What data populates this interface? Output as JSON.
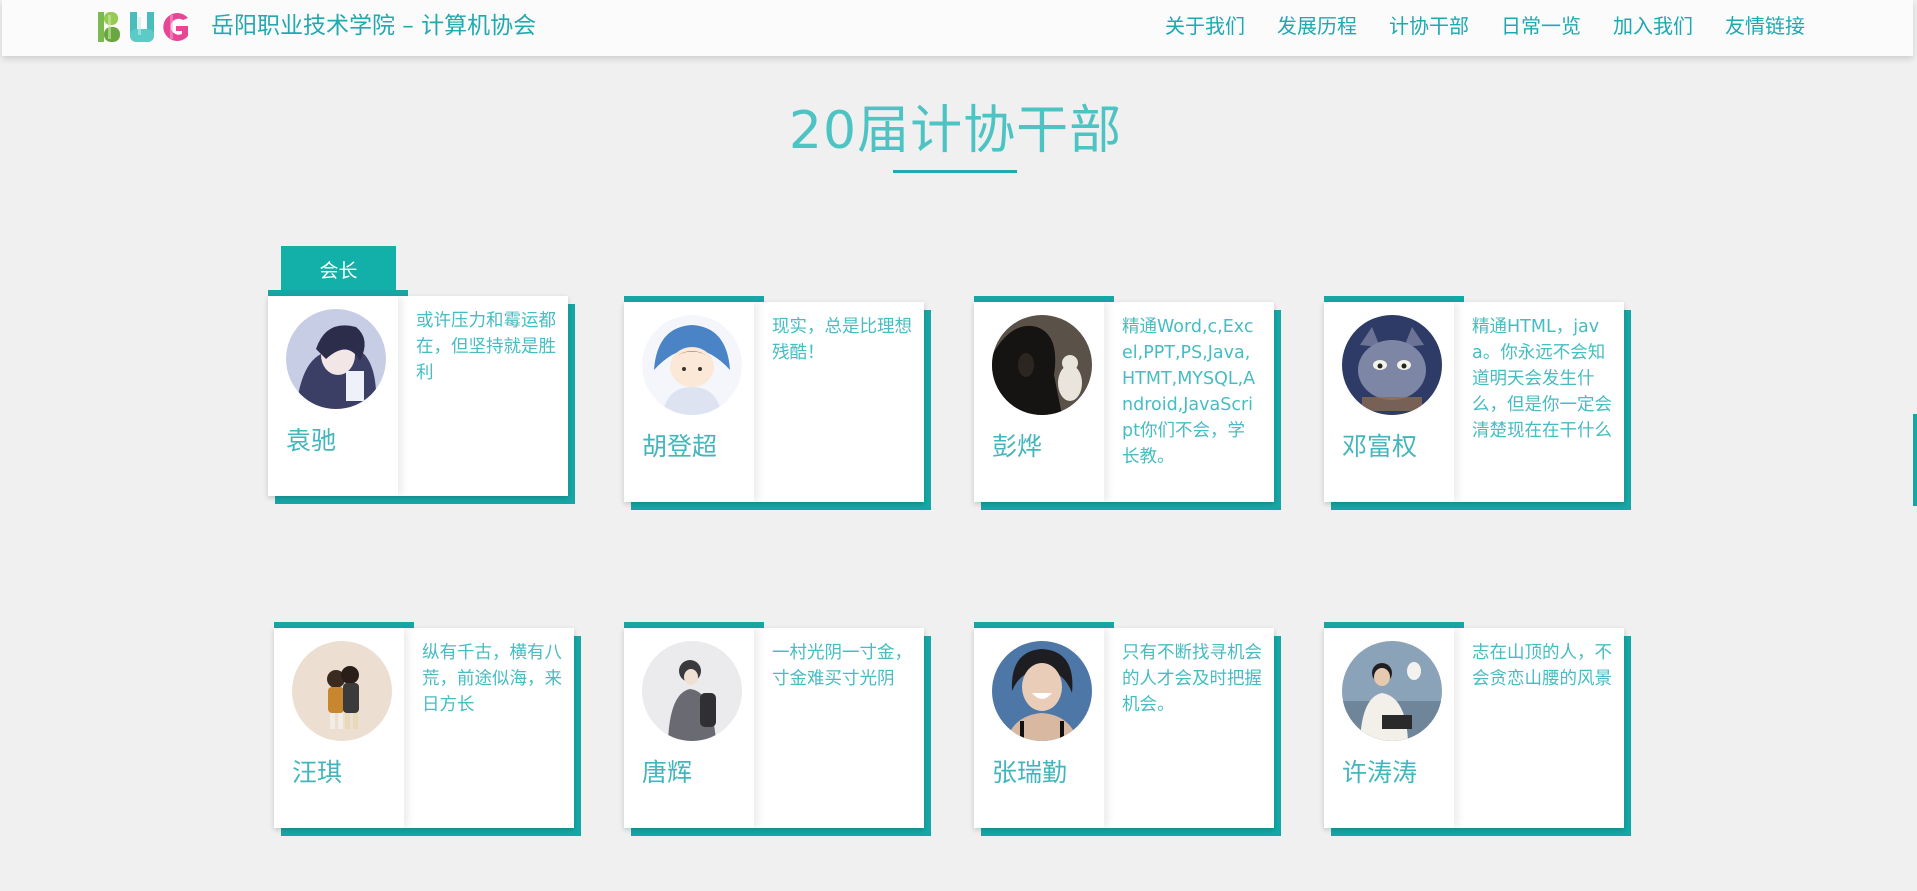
{
  "header": {
    "title": "岳阳职业技术学院 – 计算机协会",
    "logo_text": "BUG",
    "nav": [
      "关于我们",
      "发展历程",
      "计协干部",
      "日常一览",
      "加入我们",
      "友情链接"
    ]
  },
  "section": {
    "title": "20届计协干部"
  },
  "role_badge": "会长",
  "members": [
    {
      "name": "袁驰",
      "motto": "或许压力和霉运都在，但坚持就是胜利"
    },
    {
      "name": "胡登超",
      "motto": "现实，总是比理想残酷！"
    },
    {
      "name": "彭烨",
      "motto": "精通Word,c,Excel,PPT,PS,Java,HTMT,MYSQL,Android,JavaScript你们不会，学长教。"
    },
    {
      "name": "邓富权",
      "motto": "精通HTML，java。你永远不会知道明天会发生什么，但是你一定会清楚现在在干什么"
    },
    {
      "name": "汪琪",
      "motto": "纵有千古，横有八荒，前途似海，来日方长"
    },
    {
      "name": "唐辉",
      "motto": "一村光阴一寸金，寸金难买寸光阴"
    },
    {
      "name": "张瑞勤",
      "motto": "只有不断找寻机会的人才会及时把握机会。"
    },
    {
      "name": "许涛涛",
      "motto": "志在山顶的人，不会贪恋山腰的风景"
    }
  ],
  "colors": {
    "accent": "#17a6a6",
    "title": "#4ec3c3",
    "background": "#f0f0f0"
  }
}
